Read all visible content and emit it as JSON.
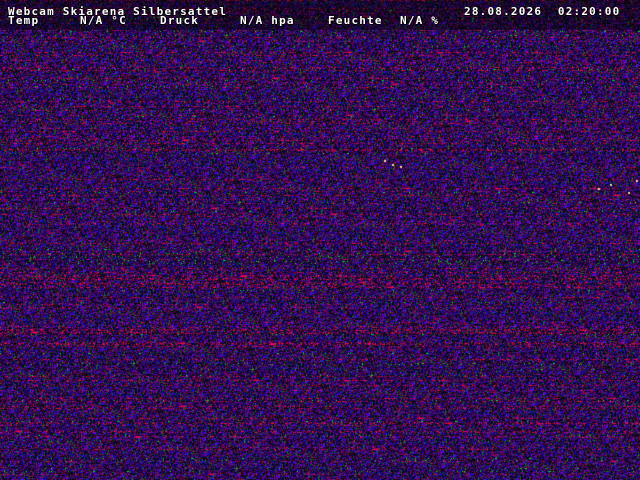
{
  "overlay": {
    "title": "Webcam Skiarena Silbersattel",
    "datetime": "28.08.2026  02:20:00",
    "temperature_label": "Temp",
    "temperature_value": "N/A °C",
    "pressure_label": "Druck",
    "pressure_value": "N/A hpa",
    "humidity_label": "Feuchte",
    "humidity_value": "N/A %"
  },
  "image": {
    "description_colors": {
      "base": "#05051a",
      "noise_blue": "#2a2aff",
      "noise_red": "#ff2a2a",
      "noise_green": "#2aff4a",
      "noise_magenta": "#c040ff"
    }
  }
}
